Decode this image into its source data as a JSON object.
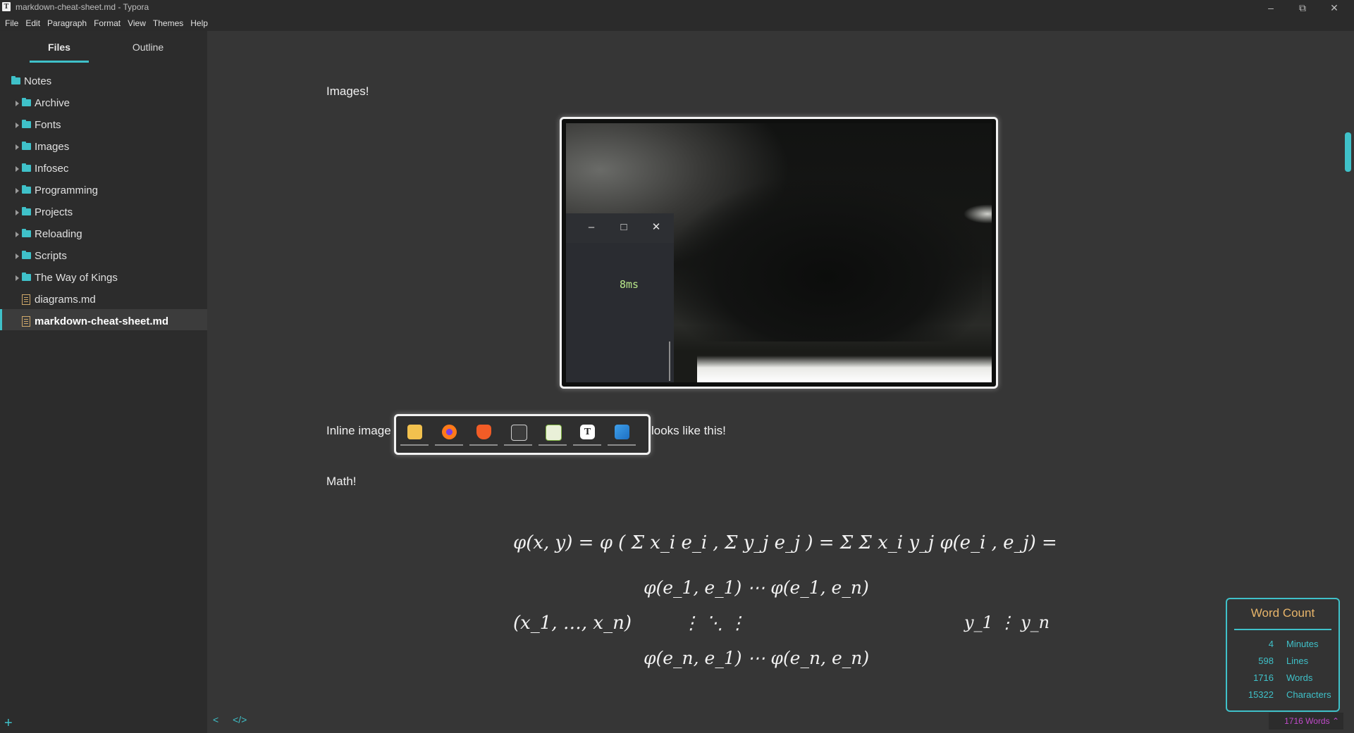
{
  "window": {
    "title": "markdown-cheat-sheet.md - Typora",
    "app_icon": "T",
    "minimize": "–",
    "maximize": "⧉",
    "close": "✕"
  },
  "menu": [
    "File",
    "Edit",
    "Paragraph",
    "Format",
    "View",
    "Themes",
    "Help"
  ],
  "sidebar": {
    "tabs": {
      "files": "Files",
      "outline": "Outline"
    },
    "root": "Notes",
    "folders": [
      "Archive",
      "Fonts",
      "Images",
      "Infosec",
      "Programming",
      "Projects",
      "Reloading",
      "Scripts",
      "The Way of Kings"
    ],
    "files": [
      "diagrams.md",
      "markdown-cheat-sheet.md"
    ],
    "active_file": "markdown-cheat-sheet.md",
    "add": "+"
  },
  "content": {
    "images_heading": "Images!",
    "inline_prefix": "Inline image",
    "inline_suffix": "looks like this!",
    "math_heading": "Math!",
    "overlay": {
      "value": "8ms",
      "min": "–",
      "max": "□",
      "close": "✕"
    },
    "dock_icons": [
      "file-explorer-icon",
      "firefox-icon",
      "brave-icon",
      "terminal-icon",
      "editor-icon",
      "typora-icon",
      "vscode-icon"
    ],
    "math": {
      "line1": "φ(x, y) = φ ( Σ x_i e_i , Σ y_j e_j ) = Σ Σ x_i y_j φ(e_i , e_j) =",
      "line2": "(x_1, …, x_n)",
      "matrix_row1": "φ(e_1, e_1)   ⋯   φ(e_1, e_n)",
      "matrix_row2": "⋮   ⋱   ⋮",
      "matrix_row3": "φ(e_n, e_1)   ⋯   φ(e_n, e_n)",
      "vector": "y_1 ⋮ y_n"
    }
  },
  "bottom": {
    "back": "<",
    "source": "</>"
  },
  "word_count": {
    "title": "Word Count",
    "rows": [
      {
        "value": "4",
        "label": "Minutes"
      },
      {
        "value": "598",
        "label": "Lines"
      },
      {
        "value": "1716",
        "label": "Words"
      },
      {
        "value": "15322",
        "label": "Characters"
      }
    ]
  },
  "status": "1716 Words ⌃",
  "colors": {
    "accent": "#3fc1c9",
    "heading_accent": "#e8b56a",
    "status_text": "#c04ac9",
    "background": "#363636",
    "sidebar": "#2c2c2c"
  }
}
